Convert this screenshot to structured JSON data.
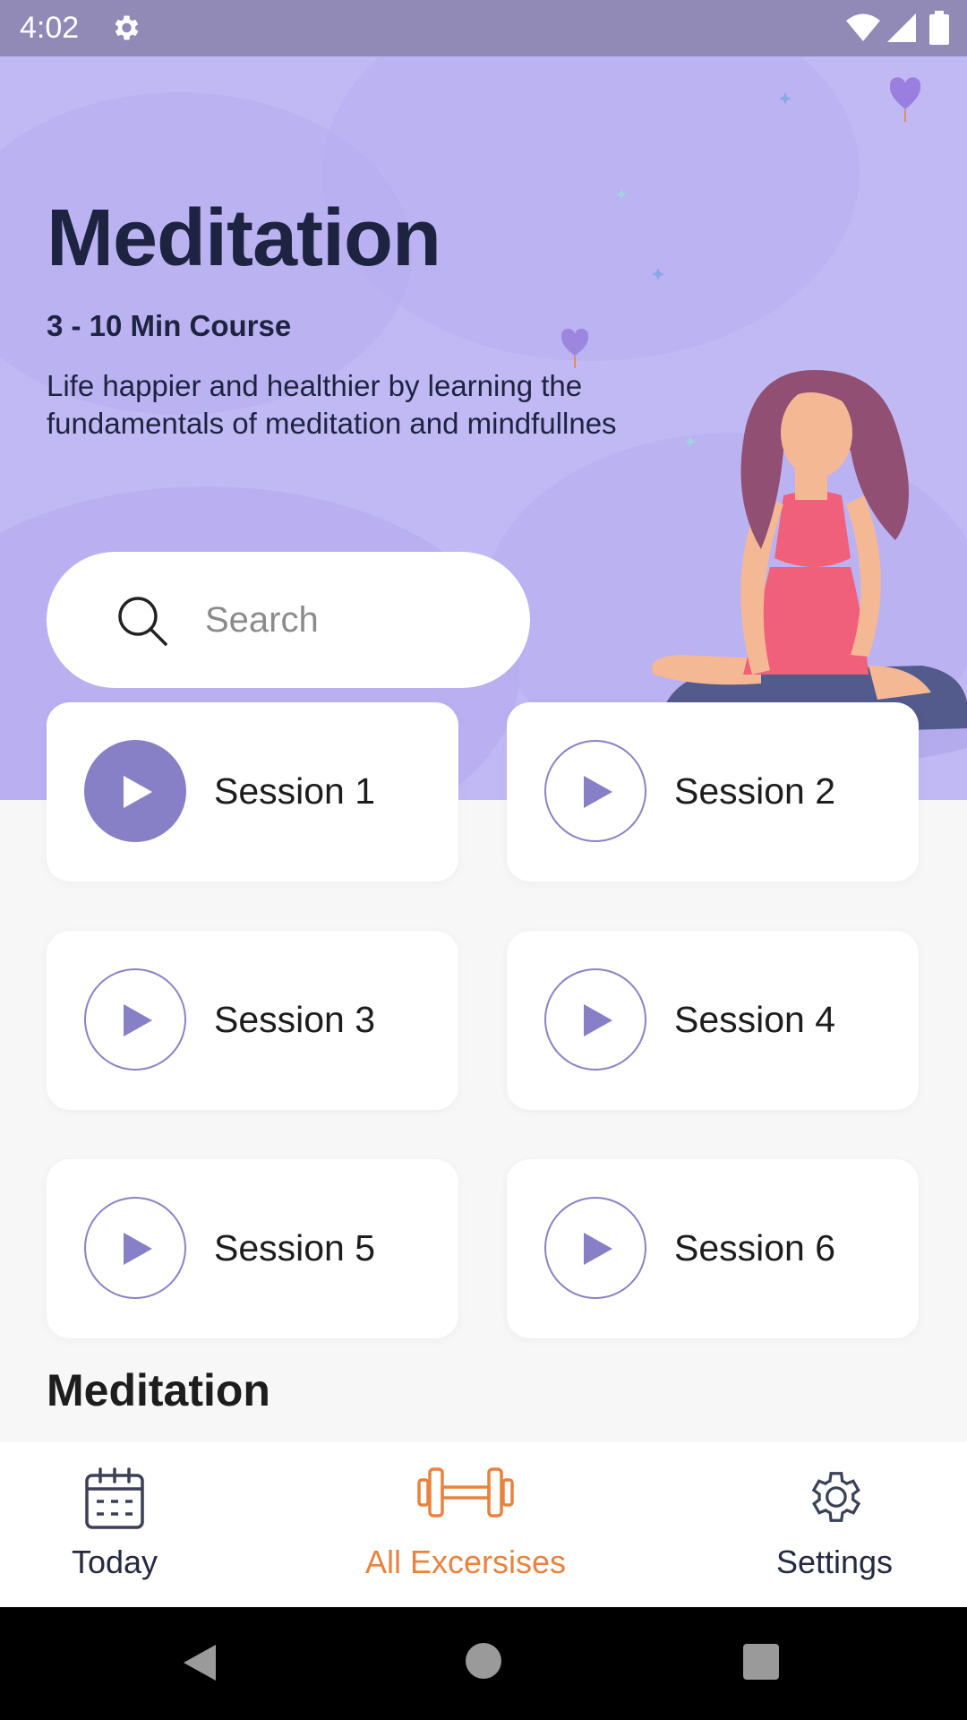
{
  "status_bar": {
    "time": "4:02"
  },
  "header": {
    "title": "Meditation",
    "subtitle": "3 - 10 Min Course",
    "description": "Life happier and healthier by learning the fundamentals of meditation and mindfullnes"
  },
  "search": {
    "placeholder": "Search",
    "value": ""
  },
  "sessions": [
    {
      "label": "Session 1",
      "active": true
    },
    {
      "label": "Session 2",
      "active": false
    },
    {
      "label": "Session 3",
      "active": false
    },
    {
      "label": "Session 4",
      "active": false
    },
    {
      "label": "Session 5",
      "active": false
    },
    {
      "label": "Session 6",
      "active": false
    }
  ],
  "section": {
    "title": "Meditation"
  },
  "bottom_nav": {
    "items": [
      {
        "label": "Today",
        "icon": "calendar-icon",
        "active": false
      },
      {
        "label": "All Excersises",
        "icon": "dumbbell-icon",
        "active": true
      },
      {
        "label": "Settings",
        "icon": "gear-icon",
        "active": false
      }
    ]
  },
  "colors": {
    "hero_background": "#c1b9f4",
    "accent_purple": "#8880c6",
    "active_nav": "#e8833f",
    "text_dark": "#1d2340"
  }
}
